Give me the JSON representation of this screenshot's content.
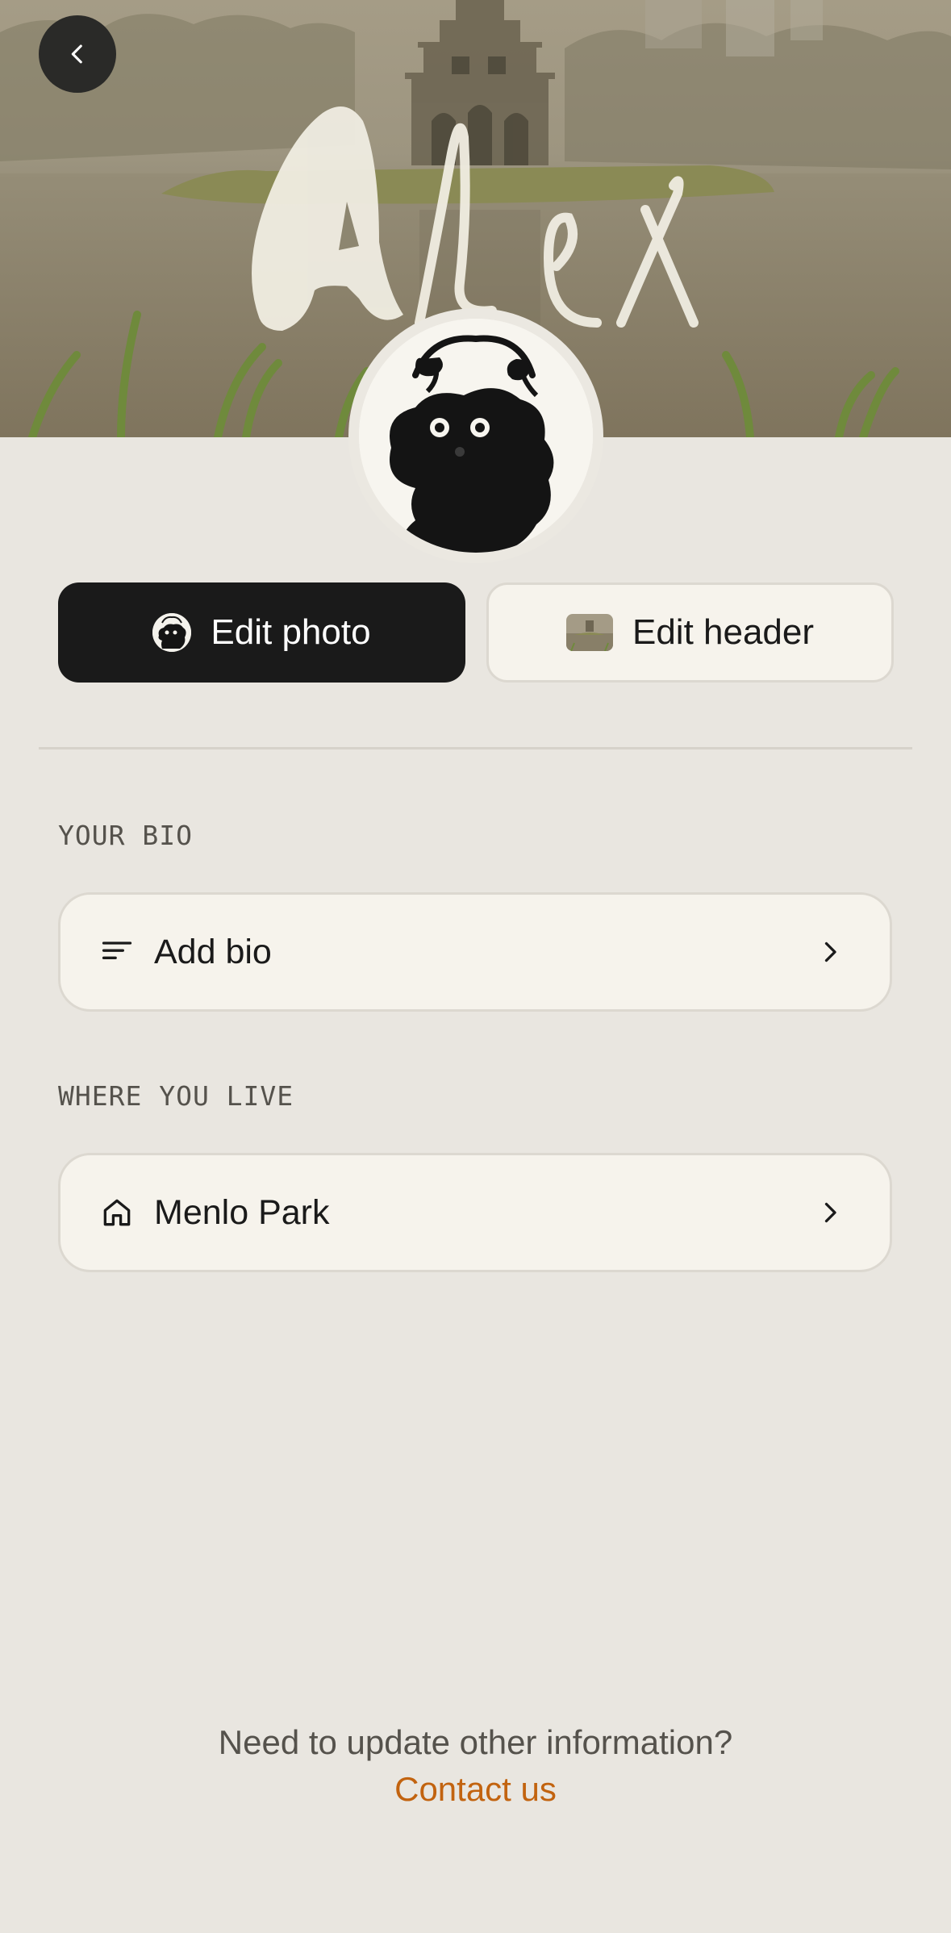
{
  "header": {
    "signature_text": "Alex",
    "back_icon": "chevron-left-icon"
  },
  "profile": {
    "avatar_icon": "avatar-drawing"
  },
  "actions": {
    "edit_photo_label": "Edit photo",
    "edit_header_label": "Edit header"
  },
  "bio": {
    "section_label": "YOUR BIO",
    "value": "Add bio",
    "icon": "text-lines-icon"
  },
  "location": {
    "section_label": "WHERE YOU LIVE",
    "value": "Menlo Park",
    "icon": "home-icon"
  },
  "footer": {
    "question": "Need to update other information?",
    "link": "Contact us"
  },
  "colors": {
    "accent": "#c2630f",
    "background": "#e9e6e0",
    "card": "#f6f3ec",
    "dark_button": "#1a1a1a"
  }
}
